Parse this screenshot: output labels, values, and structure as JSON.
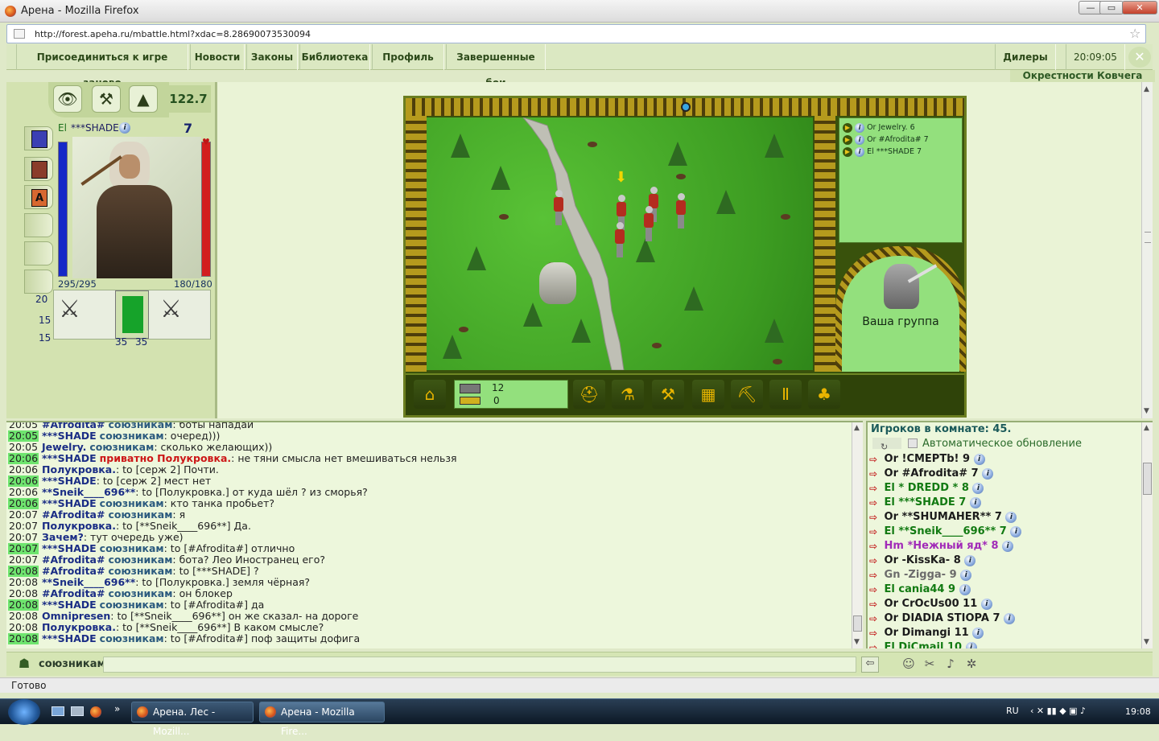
{
  "window": {
    "title": "Арена - Mozilla Firefox",
    "min": "—",
    "max": "▭",
    "close": "✕"
  },
  "address": {
    "url": "http://forest.apeha.ru/mbattle.html?xdac=8.28690073530094"
  },
  "menu": {
    "items": [
      "Присоединиться к игре заново",
      "Новости",
      "Законы",
      "Библиотека",
      "Профиль",
      "Завершенные бои"
    ],
    "dealers": "Дилеры",
    "clock": "20:09:05",
    "location": "Окрестности Ковчега"
  },
  "player": {
    "prefix": "El",
    "name": "***SHADE",
    "level": "7",
    "score": "122.7",
    "hp": "295/295",
    "mana": "180/180",
    "hp_fraction": 1.0,
    "mana_fraction": 1.0,
    "stat1": "20",
    "stat2": "15",
    "stat3": "15",
    "armor1": "35",
    "armor2": "35",
    "tabs": [
      "eye-icon",
      "tools-icon",
      "tree-icon"
    ]
  },
  "battle": {
    "queue": [
      {
        "text": "Or Jewelry. 6"
      },
      {
        "text": "Or #Afrodita# 7"
      },
      {
        "text": "El ***SHADE 7"
      }
    ],
    "group_label": "Ваша группа",
    "res1": "12",
    "res2": "0"
  },
  "chat": {
    "lines": [
      {
        "time": "20:05",
        "hl": false,
        "nick": "#Afrodita#",
        "grp": "союзникам",
        "text": ": боты нападай"
      },
      {
        "time": "20:05",
        "hl": true,
        "nick": "***SHADE",
        "grp": "союзникам",
        "text": ": очеред)))"
      },
      {
        "time": "20:05",
        "hl": false,
        "nick": "Jewelry.",
        "grp": "союзникам",
        "text": ": сколько желающих))"
      },
      {
        "time": "20:06",
        "hl": true,
        "nick": "***SHADE",
        "priv": "приватно Полукровка.",
        "text": ": не тяни смысла нет вмешиваться нельзя"
      },
      {
        "time": "20:06",
        "hl": false,
        "nick": "Полукровка.",
        "grp": "",
        "text": ": to [серж 2] Почти."
      },
      {
        "time": "20:06",
        "hl": true,
        "nick": "***SHADE",
        "grp": "",
        "text": ": to [серж 2] мест нет"
      },
      {
        "time": "20:06",
        "hl": false,
        "nick": "**Sneik____696**",
        "grp": "",
        "text": ": to [Полукровка.] от куда шёл ? из сморья?"
      },
      {
        "time": "20:06",
        "hl": true,
        "nick": "***SHADE",
        "grp": "союзникам",
        "text": ": кто танка пробьет?"
      },
      {
        "time": "20:07",
        "hl": false,
        "nick": "#Afrodita#",
        "grp": "союзникам",
        "text": ": я"
      },
      {
        "time": "20:07",
        "hl": false,
        "nick": "Полукровка.",
        "grp": "",
        "text": ": to [**Sneik____696**] Да."
      },
      {
        "time": "20:07",
        "hl": false,
        "nick": "Зачем?",
        "grp": "",
        "text": ": тут очередь уже)"
      },
      {
        "time": "20:07",
        "hl": true,
        "nick": "***SHADE",
        "grp": "союзникам",
        "text": ": to [#Afrodita#] отлично"
      },
      {
        "time": "20:07",
        "hl": false,
        "nick": "#Afrodita#",
        "grp": "союзникам",
        "text": ": бота? Лео Иностранец его?"
      },
      {
        "time": "20:08",
        "hl": true,
        "nick": "#Afrodita#",
        "grp": "союзникам",
        "text": ": to [***SHADE] ?"
      },
      {
        "time": "20:08",
        "hl": false,
        "nick": "**Sneik____696**",
        "grp": "",
        "text": ": to [Полукровка.] земля чёрная?"
      },
      {
        "time": "20:08",
        "hl": false,
        "nick": "#Afrodita#",
        "grp": "союзникам",
        "text": ": он блокер"
      },
      {
        "time": "20:08",
        "hl": true,
        "nick": "***SHADE",
        "grp": "союзникам",
        "text": ": to [#Afrodita#] да"
      },
      {
        "time": "20:08",
        "hl": false,
        "nick": "Omnipresen",
        "grp": "",
        "text": ": to [**Sneik____696**] он же сказал- на дороге"
      },
      {
        "time": "20:08",
        "hl": false,
        "nick": "Полукровка.",
        "grp": "",
        "text": ": to [**Sneik____696**] В каком смысле?"
      },
      {
        "time": "20:08",
        "hl": true,
        "nick": "***SHADE",
        "grp": "союзникам",
        "text": ": to [#Afrodita#] поф защиты дофига"
      }
    ],
    "input_prefix": "союзникам"
  },
  "users": {
    "count_text": "Игроков в комнате: 45.",
    "auto_refresh": "Автоматическое обновление",
    "list": [
      {
        "race": "Or",
        "name": "!CMEPTb!",
        "lvl": "9",
        "color": "#1b1b1b"
      },
      {
        "race": "Or",
        "name": "#Afrodita#",
        "lvl": "7",
        "color": "#1b1b1b"
      },
      {
        "race": "El",
        "name": "* DREDD *",
        "lvl": "8",
        "color": "#127a12"
      },
      {
        "race": "El",
        "name": "***SHADE",
        "lvl": "7",
        "color": "#127a12"
      },
      {
        "race": "Or",
        "name": "**SHUMAHER**",
        "lvl": "7",
        "color": "#1b1b1b"
      },
      {
        "race": "El",
        "name": "**Sneik____696**",
        "lvl": "7",
        "color": "#127a12"
      },
      {
        "race": "Hm",
        "name": "*Нежный яд*",
        "lvl": "8",
        "color": "#a12bb8"
      },
      {
        "race": "Or",
        "name": "-KissKa-",
        "lvl": "8",
        "color": "#1b1b1b"
      },
      {
        "race": "Gn",
        "name": "-Zigga-",
        "lvl": "9",
        "color": "#6b6b6b"
      },
      {
        "race": "El",
        "name": "cania44",
        "lvl": "9",
        "color": "#127a12"
      },
      {
        "race": "Or",
        "name": "CrOcUs00",
        "lvl": "11",
        "color": "#1b1b1b"
      },
      {
        "race": "Or",
        "name": "DIADIA STIOPA",
        "lvl": "7",
        "color": "#1b1b1b"
      },
      {
        "race": "Or",
        "name": "Dimangi",
        "lvl": "11",
        "color": "#1b1b1b"
      },
      {
        "race": "El",
        "name": "DiCmail",
        "lvl": "10",
        "color": "#127a12"
      }
    ]
  },
  "status": {
    "text": "Готово"
  },
  "taskbar": {
    "tasks": [
      "Арена. Лес - Mozill...",
      "Арена - Mozilla Fire..."
    ],
    "lang": "RU",
    "time": "19:08"
  }
}
